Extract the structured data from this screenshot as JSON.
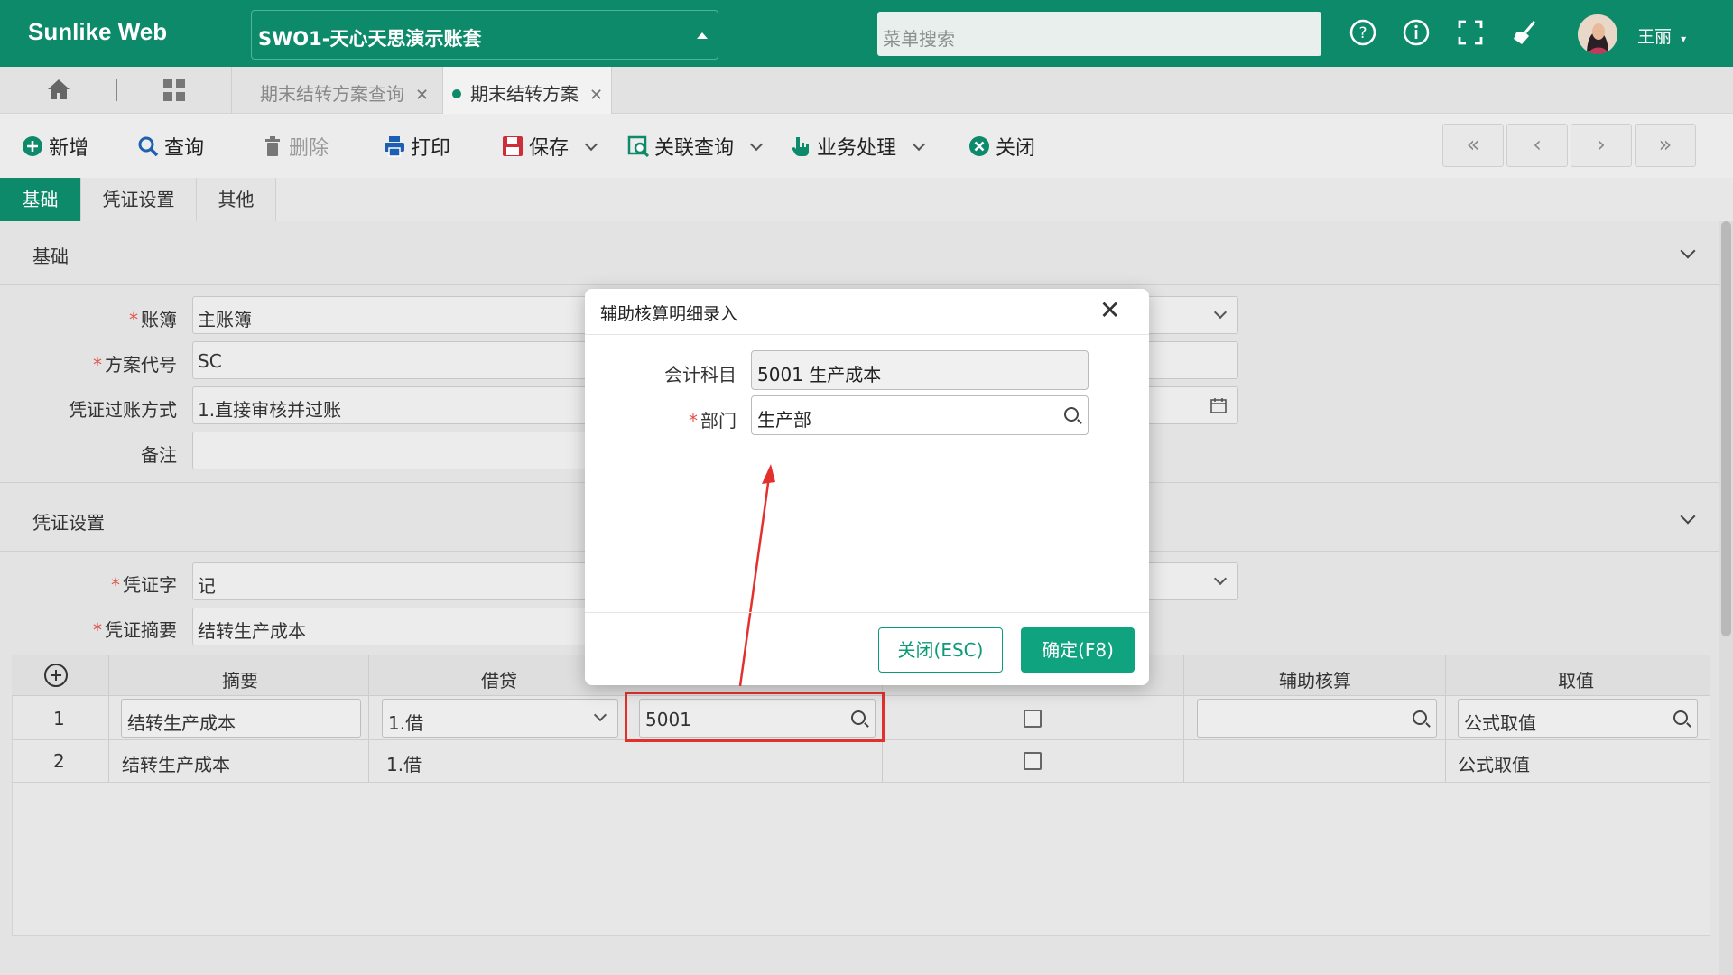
{
  "header": {
    "brand": "Sunlike Web",
    "account_set": "SWO1-天心天思演示账套",
    "menu_search_placeholder": "菜单搜索",
    "user_name": "王丽",
    "icons": [
      "help-icon",
      "info-icon",
      "fullscreen-icon",
      "clean-icon"
    ]
  },
  "tabs": [
    {
      "label": "期末结转方案查询",
      "active": false
    },
    {
      "label": "期末结转方案",
      "active": true
    }
  ],
  "toolbar": {
    "new": "新增",
    "query": "查询",
    "delete": "删除",
    "print": "打印",
    "save": "保存",
    "related_query": "关联查询",
    "business": "业务处理",
    "close": "关闭",
    "nav": [
      "«",
      "‹",
      "›",
      "»"
    ]
  },
  "subtabs": [
    "基础",
    "凭证设置",
    "其他"
  ],
  "basic_section": {
    "title": "基础",
    "fields": {
      "ledger_label": "账簿",
      "ledger_value": "主账簿",
      "plan_code_label": "方案代号",
      "plan_code_value": "SC",
      "posting_label": "凭证过账方式",
      "posting_value": "1.直接审核并过账",
      "remark_label": "备注",
      "remark_value": ""
    }
  },
  "voucher_section": {
    "title": "凭证设置",
    "voucher_word_label": "凭证字",
    "voucher_word_value": "记",
    "summary_label": "凭证摘要",
    "summary_value": "结转生产成本"
  },
  "grid": {
    "headers": [
      "摘要",
      "借贷",
      "辅助核算",
      "取值"
    ],
    "rows": [
      {
        "no": "1",
        "summary": "结转生产成本",
        "dc": "1.借",
        "account": "5001",
        "value": "公式取值"
      },
      {
        "no": "2",
        "summary": "结转生产成本",
        "dc": "1.借",
        "account": "",
        "value": "公式取值"
      }
    ]
  },
  "modal": {
    "title": "辅助核算明细录入",
    "account_label": "会计科目",
    "account_value": "5001 生产成本",
    "dept_label": "部门",
    "dept_value": "生产部",
    "cancel": "关闭(ESC)",
    "ok": "确定(F8)"
  },
  "colors": {
    "brand": "#0d8a6a",
    "button": "#10a37f",
    "highlight": "#e2312d"
  }
}
